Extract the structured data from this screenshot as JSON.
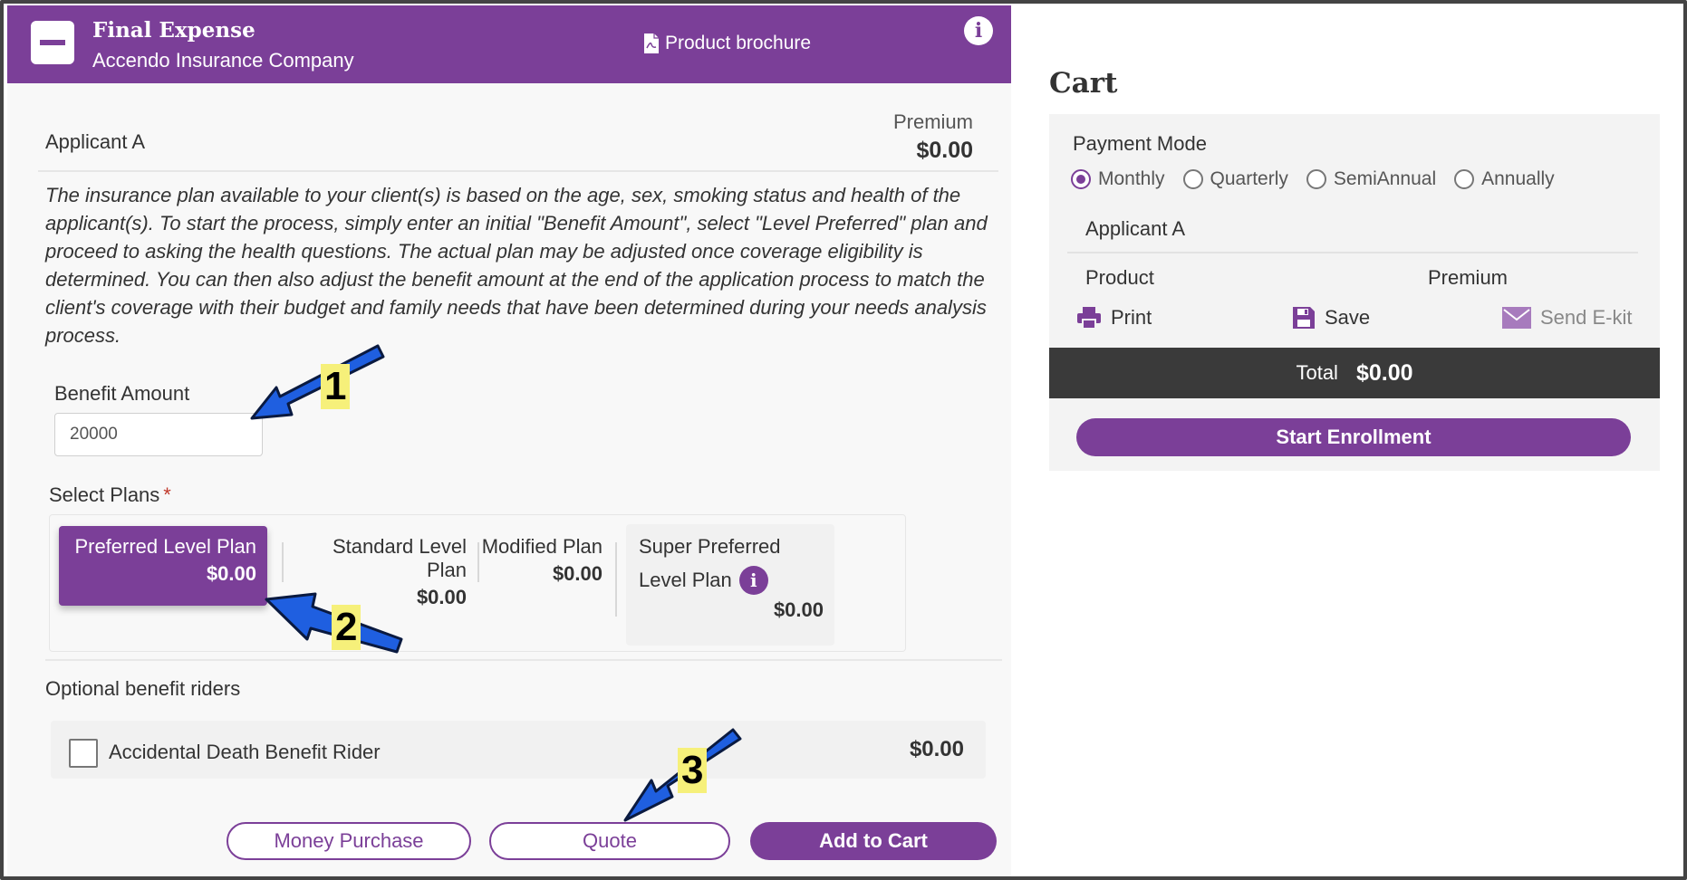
{
  "product": {
    "title": "Final Expense",
    "company": "Accendo Insurance Company",
    "brochure_label": "Product brochure",
    "info_glyph": "i"
  },
  "applicant": {
    "label": "Applicant A",
    "premium_label": "Premium",
    "premium_value": "$0.00"
  },
  "intro_text": "The insurance plan available to your client(s) is based on the age, sex, smoking status and health of the applicant(s). To start the process, simply enter an initial \"Benefit Amount\", select \"Level Preferred\" plan and proceed to asking the health questions. The actual plan may be adjusted once coverage eligibility is determined. You can then also adjust the benefit amount at the end of the application process to match the client's coverage with their budget and family needs that have been determined during your needs analysis process.",
  "benefit": {
    "label": "Benefit Amount",
    "value": "20000"
  },
  "plans": {
    "label": "Select Plans",
    "required_marker": "*",
    "items": [
      {
        "name": "Preferred Level Plan",
        "price": "$0.00"
      },
      {
        "name": "Standard Level Plan",
        "price": "$0.00"
      },
      {
        "name": "Modified Plan",
        "price": "$0.00"
      },
      {
        "name_line1": "Super Preferred",
        "name_line2": "Level Plan",
        "price": "$0.00"
      }
    ]
  },
  "riders": {
    "label": "Optional benefit riders",
    "items": [
      {
        "name": "Accidental Death Benefit Rider",
        "price": "$0.00"
      }
    ]
  },
  "buttons": {
    "money_purchase": "Money Purchase",
    "quote": "Quote",
    "add_to_cart": "Add to Cart"
  },
  "cart": {
    "title": "Cart",
    "payment_mode_label": "Payment Mode",
    "payment_modes": [
      "Monthly",
      "Quarterly",
      "SemiAnnual",
      "Annually"
    ],
    "selected_mode": "Monthly",
    "applicant": "Applicant A",
    "col_product": "Product",
    "col_premium": "Premium",
    "print_label": "Print",
    "save_label": "Save",
    "ekit_label": "Send E-kit",
    "total_label": "Total",
    "total_value": "$0.00",
    "start_enrollment": "Start Enrollment"
  },
  "annotations": [
    "1",
    "2",
    "3"
  ],
  "colors": {
    "brand_purple": "#7b3f98",
    "total_bar": "#3a3a3a",
    "arrow_blue": "#1f5fe0",
    "label_yellow": "#f6f07a"
  }
}
